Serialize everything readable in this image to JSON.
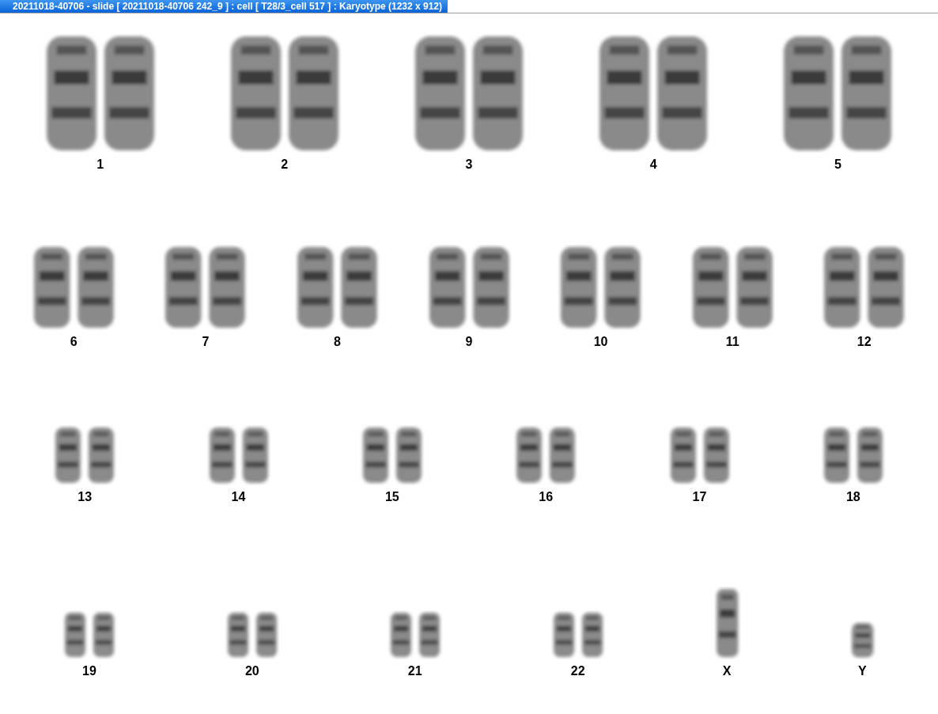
{
  "window": {
    "title": "20211018-40706 - slide [ 20211018-40706 242_9 ] : cell [ T28/3_cell 517 ] : Karyotype  (1232 x 912)"
  },
  "karyotype_rows": [
    {
      "items": [
        {
          "label": "1",
          "kind": "pair"
        },
        {
          "label": "2",
          "kind": "pair"
        },
        {
          "label": "3",
          "kind": "pair"
        },
        {
          "label": "4",
          "kind": "pair"
        },
        {
          "label": "5",
          "kind": "pair"
        }
      ]
    },
    {
      "items": [
        {
          "label": "6",
          "kind": "pair"
        },
        {
          "label": "7",
          "kind": "pair"
        },
        {
          "label": "8",
          "kind": "pair"
        },
        {
          "label": "9",
          "kind": "pair"
        },
        {
          "label": "10",
          "kind": "pair"
        },
        {
          "label": "11",
          "kind": "pair"
        },
        {
          "label": "12",
          "kind": "pair"
        }
      ]
    },
    {
      "items": [
        {
          "label": "13",
          "kind": "pair"
        },
        {
          "label": "14",
          "kind": "pair"
        },
        {
          "label": "15",
          "kind": "pair"
        },
        {
          "label": "16",
          "kind": "pair"
        },
        {
          "label": "17",
          "kind": "pair"
        },
        {
          "label": "18",
          "kind": "pair"
        }
      ]
    },
    {
      "items": [
        {
          "label": "19",
          "kind": "pair"
        },
        {
          "label": "20",
          "kind": "pair"
        },
        {
          "label": "21",
          "kind": "pair"
        },
        {
          "label": "22",
          "kind": "pair"
        },
        {
          "label": "X",
          "kind": "single"
        },
        {
          "label": "Y",
          "kind": "single"
        }
      ]
    }
  ]
}
